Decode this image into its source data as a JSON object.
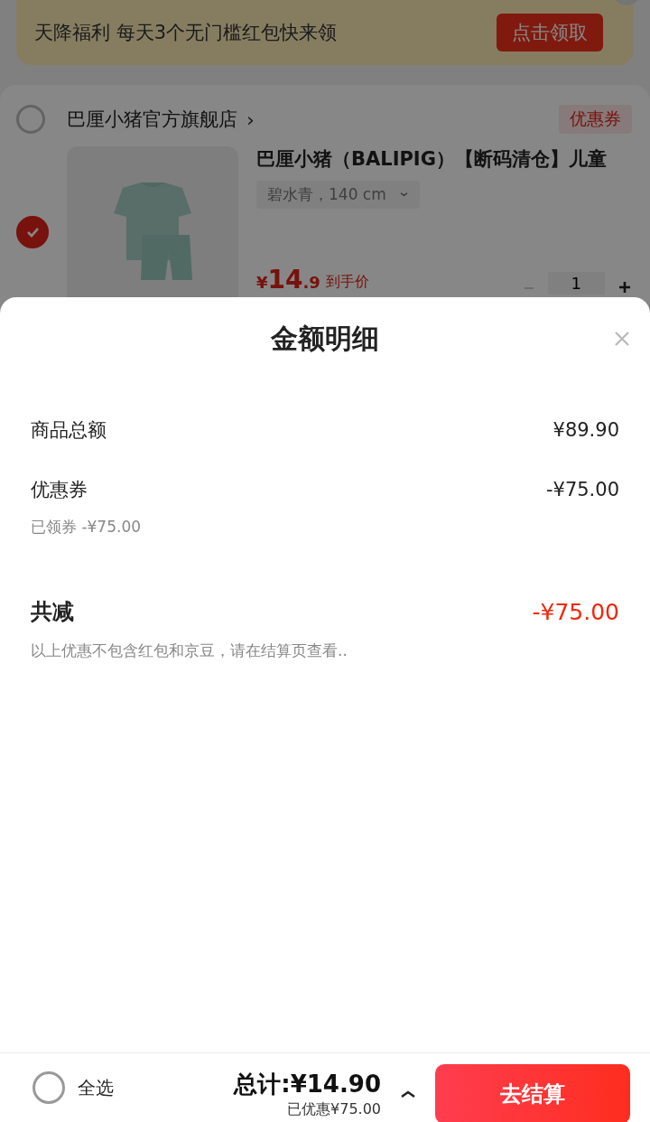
{
  "banner": {
    "text": "天降福利 每天3个无门槛红包快来领",
    "button": "点击领取"
  },
  "store": {
    "name": "巴厘小猪官方旗舰店",
    "arrow": "›",
    "selected": false,
    "coupon": "优惠券"
  },
  "product": {
    "selected": true,
    "title": "巴厘小猪（BALIPIG）【断码清仓】儿童",
    "spec": "碧水青，140 cm",
    "price_symbol": "¥",
    "price_int": "14",
    "price_dec": ".9",
    "price_note": "到手价",
    "quantity": "1"
  },
  "sheet": {
    "title": "金额明细",
    "rows": [
      {
        "kind": "line",
        "label": "商品总额",
        "value": "¥89.90"
      },
      {
        "kind": "line",
        "label": "优惠券",
        "value": "-¥75.00",
        "note": "已领券 -¥75.00"
      },
      {
        "kind": "total",
        "label": "共减",
        "value": "-¥75.00",
        "note": "以上优惠不包含红包和京豆，请在结算页查看.."
      }
    ]
  },
  "footer": {
    "select_all": "全选",
    "selected": false,
    "total": "总计:¥14.90",
    "saved": "已优惠¥75.00",
    "checkout": "去结算"
  }
}
